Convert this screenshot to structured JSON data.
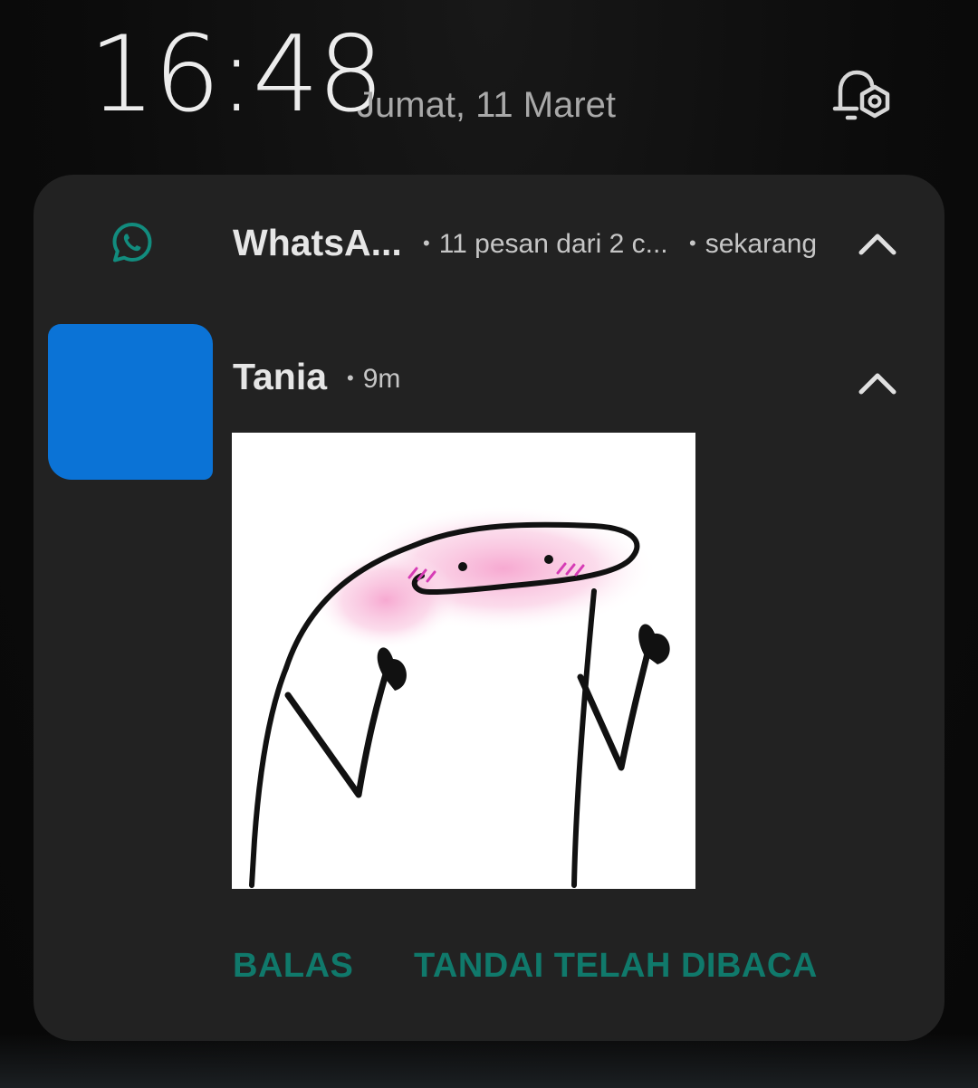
{
  "lockscreen": {
    "time": "16:48",
    "date": "Jumat, 11 Maret"
  },
  "notification": {
    "app_name": "WhatsA...",
    "summary": "11 pesan dari 2 c...",
    "posted": "sekarang",
    "message": {
      "sender": "Tania",
      "age": "9m"
    },
    "actions": {
      "reply": "BALAS",
      "mark_read": "TANDAI TELAH DIBACA"
    }
  },
  "colors": {
    "accent": "#10796b",
    "whatsapp_green": "#128c7e",
    "avatar_redaction": "#0b73d6",
    "card_bg": "#222222"
  },
  "icons": {
    "notification_settings": "bell-gear-icon",
    "app": "whatsapp-icon",
    "collapse": "chevron-up-icon"
  }
}
